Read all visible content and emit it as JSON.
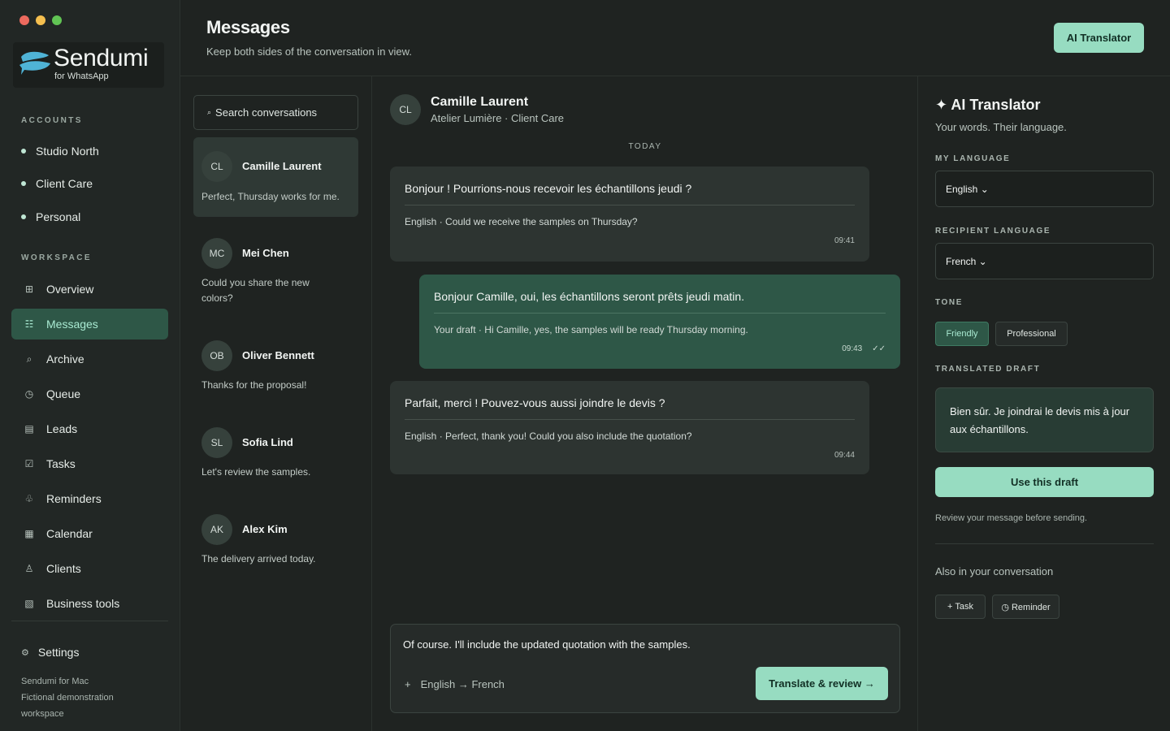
{
  "app": {
    "name": "Sendumi",
    "subtitle": "for WhatsApp"
  },
  "sidebar": {
    "accounts_label": "ACCOUNTS",
    "accounts": [
      {
        "label": "Studio North"
      },
      {
        "label": "Client Care"
      },
      {
        "label": "Personal"
      }
    ],
    "workspace_label": "WORKSPACE",
    "nav": [
      {
        "label": "Overview",
        "icon": "grid-icon",
        "glyph": "⊞"
      },
      {
        "label": "Messages",
        "icon": "list-icon",
        "glyph": "☷"
      },
      {
        "label": "Archive",
        "icon": "search-icon",
        "glyph": "⌕"
      },
      {
        "label": "Queue",
        "icon": "clock-icon",
        "glyph": "◷"
      },
      {
        "label": "Leads",
        "icon": "table-icon",
        "glyph": "▤"
      },
      {
        "label": "Tasks",
        "icon": "checkbox-icon",
        "glyph": "☑"
      },
      {
        "label": "Reminders",
        "icon": "bell-icon",
        "glyph": "♧"
      },
      {
        "label": "Calendar",
        "icon": "calendar-icon",
        "glyph": "▦"
      },
      {
        "label": "Clients",
        "icon": "person-icon",
        "glyph": "♙"
      },
      {
        "label": "Business tools",
        "icon": "tools-icon",
        "glyph": "▧"
      }
    ],
    "active_nav": "Messages",
    "settings_label": "Settings",
    "footer": [
      "Sendumi for Mac",
      "Fictional demonstration",
      "workspace"
    ]
  },
  "header": {
    "title": "Messages",
    "subtitle": "Keep both sides of the conversation in view.",
    "ai_button": "AI Translator"
  },
  "conversations": {
    "search_placeholder": "Search conversations",
    "items": [
      {
        "initials": "CL",
        "name": "Camille Laurent",
        "preview": "Perfect, Thursday works for me."
      },
      {
        "initials": "MC",
        "name": "Mei Chen",
        "preview": "Could you share the new colors?"
      },
      {
        "initials": "OB",
        "name": "Oliver Bennett",
        "preview": "Thanks for the proposal!"
      },
      {
        "initials": "SL",
        "name": "Sofia Lind",
        "preview": "Let's review the samples."
      },
      {
        "initials": "AK",
        "name": "Alex Kim",
        "preview": "The delivery arrived today."
      }
    ]
  },
  "chat": {
    "contact_initials": "CL",
    "contact_name": "Camille Laurent",
    "contact_meta": "Atelier Lumière · Client Care",
    "day_label": "TODAY",
    "messages": [
      {
        "direction": "in",
        "text": "Bonjour ! Pourrions-nous recevoir les échantillons jeudi ?",
        "translation": "English · Could we receive the samples on Thursday?",
        "time": "09:41"
      },
      {
        "direction": "out",
        "text": "Bonjour Camille, oui, les échantillons seront prêts jeudi matin.",
        "translation": "Your draft · Hi Camille, yes, the samples will be ready Thursday morning.",
        "time": "09:43",
        "ticks": "✓✓"
      },
      {
        "direction": "in",
        "text": "Parfait, merci ! Pouvez-vous aussi joindre le devis ?",
        "translation": "English · Perfect, thank you! Could you also include the quotation?",
        "time": "09:44"
      }
    ],
    "composer": {
      "text": "Of course. I'll include the updated quotation with the samples.",
      "plus": "+",
      "lang": "English → French",
      "button": "Translate & review →"
    }
  },
  "ai_panel": {
    "title": "✦ AI Translator",
    "subtitle": "Your words. Their language.",
    "my_language_label": "MY LANGUAGE",
    "my_language": "English ⌄",
    "recipient_language_label": "RECIPIENT LANGUAGE",
    "recipient_language": "French ⌄",
    "tone_label": "TONE",
    "tones": [
      "Friendly",
      "Professional"
    ],
    "selected_tone": "Friendly",
    "draft_label": "TRANSLATED DRAFT",
    "draft": "Bien sûr. Je joindrai le devis mis à jour aux échantillons.",
    "use_button": "Use this draft",
    "review_note": "Review your message before sending.",
    "also_label": "Also in your conversation",
    "extra_actions": [
      "+ Task",
      "◷ Reminder"
    ]
  },
  "colors": {
    "accent": "#97dcc1",
    "active_bg": "#2e5747",
    "background": "#1f2321"
  }
}
